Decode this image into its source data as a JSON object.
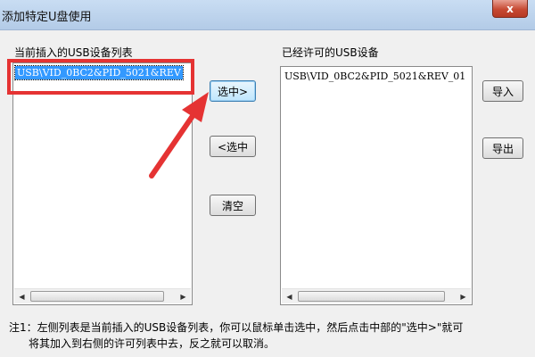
{
  "window": {
    "title": "添加特定U盘使用",
    "close_label": "x"
  },
  "left_list": {
    "label": "当前插入的USB设备列表",
    "items": [
      "USB\\VID_0BC2&PID_5021&REV"
    ]
  },
  "right_list": {
    "label": "已经许可的USB设备",
    "items": [
      "USB\\VID_0BC2&PID_5021&REV_01"
    ]
  },
  "buttons": {
    "select": "选中>",
    "unselect": "<选中",
    "clear": "清空",
    "import": "导入",
    "export": "导出"
  },
  "note": {
    "line1": "注1：左侧列表是当前插入的USB设备列表，你可以鼠标单击选中，然后点击中部的\"选中>\"就可",
    "line2": "将其加入到右侧的许可列表中去，反之就可以取消。"
  },
  "colors": {
    "highlight": "#e53333",
    "arrow": "#e53333",
    "selection": "#3399ff"
  }
}
